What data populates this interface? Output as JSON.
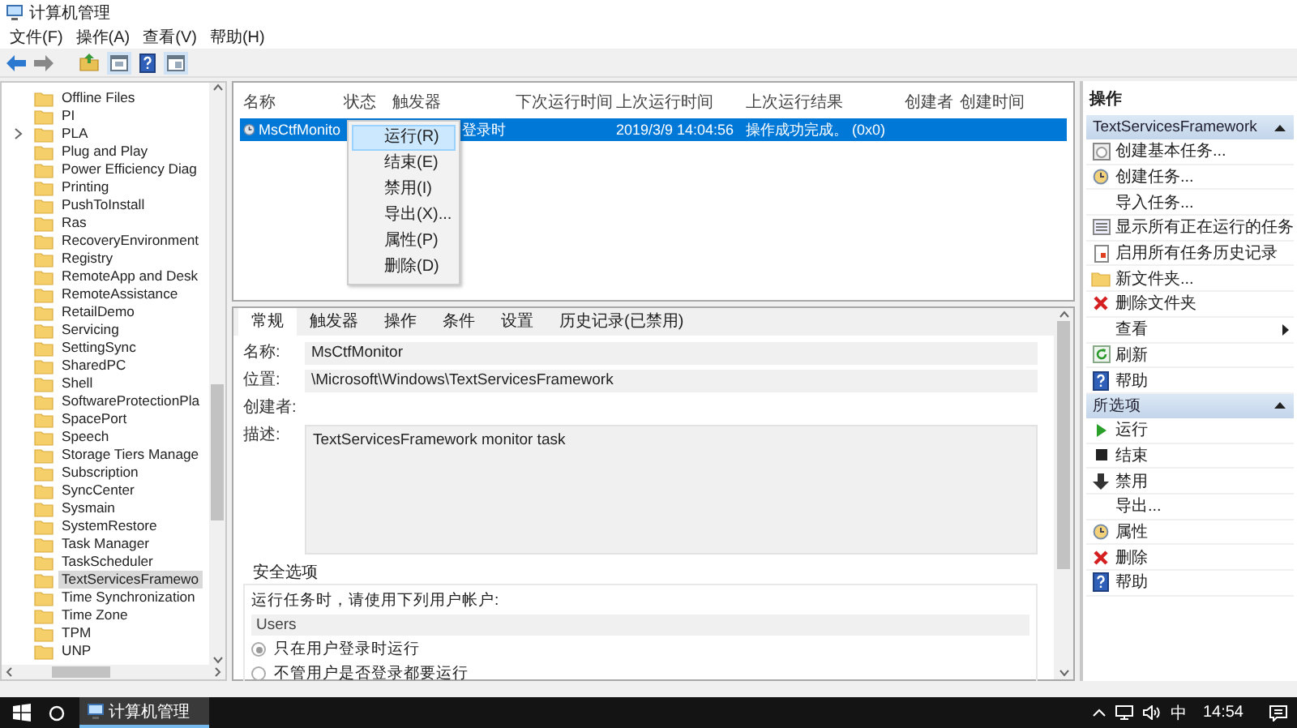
{
  "window": {
    "title": "计算机管理"
  },
  "menu": [
    "文件(F)",
    "操作(A)",
    "查看(V)",
    "帮助(H)"
  ],
  "tree": {
    "items": [
      {
        "label": "Offline Files",
        "selected": false,
        "collapsed": false
      },
      {
        "label": "PI",
        "selected": false,
        "collapsed": false
      },
      {
        "label": "PLA",
        "selected": false,
        "collapsed": true
      },
      {
        "label": "Plug and Play",
        "selected": false,
        "collapsed": false
      },
      {
        "label": "Power Efficiency Diag",
        "selected": false,
        "collapsed": false
      },
      {
        "label": "Printing",
        "selected": false,
        "collapsed": false
      },
      {
        "label": "PushToInstall",
        "selected": false,
        "collapsed": false
      },
      {
        "label": "Ras",
        "selected": false,
        "collapsed": false
      },
      {
        "label": "RecoveryEnvironment",
        "selected": false,
        "collapsed": false
      },
      {
        "label": "Registry",
        "selected": false,
        "collapsed": false
      },
      {
        "label": "RemoteApp and Desk",
        "selected": false,
        "collapsed": false
      },
      {
        "label": "RemoteAssistance",
        "selected": false,
        "collapsed": false
      },
      {
        "label": "RetailDemo",
        "selected": false,
        "collapsed": false
      },
      {
        "label": "Servicing",
        "selected": false,
        "collapsed": false
      },
      {
        "label": "SettingSync",
        "selected": false,
        "collapsed": false
      },
      {
        "label": "SharedPC",
        "selected": false,
        "collapsed": false
      },
      {
        "label": "Shell",
        "selected": false,
        "collapsed": false
      },
      {
        "label": "SoftwareProtectionPla",
        "selected": false,
        "collapsed": false
      },
      {
        "label": "SpacePort",
        "selected": false,
        "collapsed": false
      },
      {
        "label": "Speech",
        "selected": false,
        "collapsed": false
      },
      {
        "label": "Storage Tiers Manage",
        "selected": false,
        "collapsed": false
      },
      {
        "label": "Subscription",
        "selected": false,
        "collapsed": false
      },
      {
        "label": "SyncCenter",
        "selected": false,
        "collapsed": false
      },
      {
        "label": "Sysmain",
        "selected": false,
        "collapsed": false
      },
      {
        "label": "SystemRestore",
        "selected": false,
        "collapsed": false
      },
      {
        "label": "Task Manager",
        "selected": false,
        "collapsed": false
      },
      {
        "label": "TaskScheduler",
        "selected": false,
        "collapsed": false
      },
      {
        "label": "TextServicesFramewo",
        "selected": true,
        "collapsed": false
      },
      {
        "label": "Time Synchronization",
        "selected": false,
        "collapsed": false
      },
      {
        "label": "Time Zone",
        "selected": false,
        "collapsed": false
      },
      {
        "label": "TPM",
        "selected": false,
        "collapsed": false
      },
      {
        "label": "UNP",
        "selected": false,
        "collapsed": false
      }
    ]
  },
  "task_list": {
    "columns": [
      "名称",
      "状态",
      "触发器",
      "下次运行时间",
      "上次运行时间",
      "上次运行结果",
      "创建者",
      "创建时间"
    ],
    "rows": [
      {
        "name": "MsCtfMonito",
        "trigger": "登录时",
        "last_run": "2019/3/9 14:04:56",
        "result": "操作成功完成。 (0x0)",
        "selected": true
      }
    ]
  },
  "context_menu": {
    "items": [
      {
        "label": "运行(R)",
        "selected": true
      },
      {
        "label": "结束(E)",
        "selected": false
      },
      {
        "label": "禁用(I)",
        "selected": false
      },
      {
        "label": "导出(X)...",
        "selected": false
      },
      {
        "label": "属性(P)",
        "selected": false
      },
      {
        "label": "删除(D)",
        "selected": false
      }
    ]
  },
  "details": {
    "tabs": [
      {
        "label": "常规",
        "selected": true
      },
      {
        "label": "触发器",
        "selected": false
      },
      {
        "label": "操作",
        "selected": false
      },
      {
        "label": "条件",
        "selected": false
      },
      {
        "label": "设置",
        "selected": false
      },
      {
        "label": "历史记录(已禁用)",
        "selected": false
      }
    ],
    "fields": [
      {
        "label": "名称:",
        "value": "MsCtfMonitor",
        "kind": "line"
      },
      {
        "label": "位置:",
        "value": "\\Microsoft\\Windows\\TextServicesFramework",
        "kind": "line"
      },
      {
        "label": "创建者:",
        "kind": "none"
      },
      {
        "label": "描述:",
        "value": "TextServicesFramework monitor task",
        "kind": "area"
      }
    ],
    "security": {
      "title": "安全选项",
      "prompt": "运行任务时，请使用下列用户帐户:",
      "account": "Users",
      "options": [
        {
          "label": "只在用户登录时运行",
          "selected": true
        },
        {
          "label": "不管用户是否登录都要运行",
          "selected": false
        }
      ]
    }
  },
  "actions": {
    "title": "操作",
    "sections": [
      {
        "title": "TextServicesFramework",
        "expanded": true,
        "items": [
          {
            "label": "创建基本任务...",
            "kind": "calendar"
          },
          {
            "label": "创建任务...",
            "kind": "clock"
          },
          {
            "label": "导入任务...",
            "kind": "none"
          },
          {
            "label": "显示所有正在运行的任务",
            "kind": "list"
          },
          {
            "label": "启用所有任务历史记录",
            "kind": "document"
          },
          {
            "label": "新文件夹...",
            "kind": "folder"
          },
          {
            "label": "删除文件夹",
            "kind": "delete"
          },
          {
            "label": "查看",
            "kind": "submenu"
          },
          {
            "label": "刷新",
            "kind": "refresh"
          },
          {
            "label": "帮助",
            "kind": "help"
          }
        ]
      },
      {
        "title": "所选项",
        "expanded": true,
        "items": [
          {
            "label": "运行",
            "kind": "run"
          },
          {
            "label": "结束",
            "kind": "stop"
          },
          {
            "label": "禁用",
            "kind": "disable"
          },
          {
            "label": "导出...",
            "kind": "none"
          },
          {
            "label": "属性",
            "kind": "clock"
          },
          {
            "label": "删除",
            "kind": "delete"
          },
          {
            "label": "帮助",
            "kind": "help"
          }
        ]
      }
    ]
  },
  "taskbar": {
    "apps": [
      {
        "label": "计算机管理",
        "selected": true
      }
    ],
    "ime": "中",
    "time": "14:54"
  }
}
